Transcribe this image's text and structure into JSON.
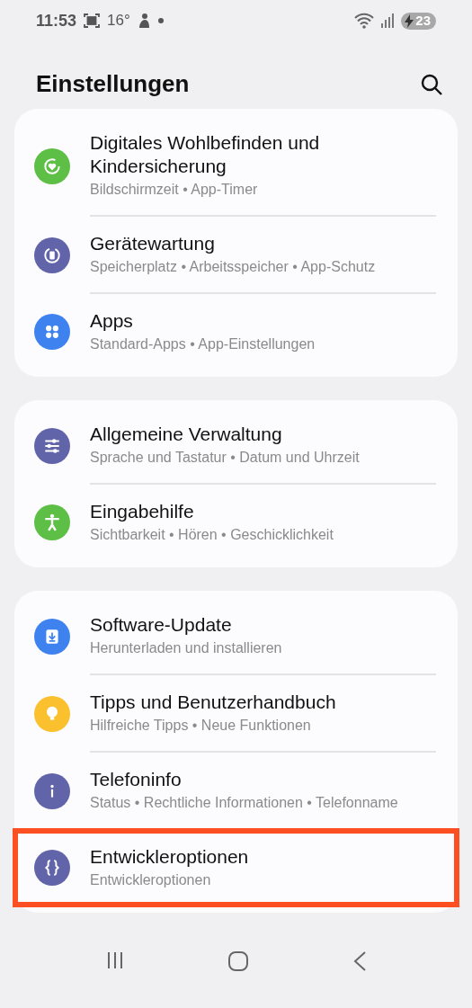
{
  "status_bar": {
    "time": "11:53",
    "temperature": "16°",
    "battery": "23"
  },
  "header": {
    "title": "Einstellungen"
  },
  "groups": [
    {
      "items": [
        {
          "kind": "wellbeing",
          "color": "#5dbf45",
          "title": "Digitales Wohlbefinden und Kindersicherung",
          "subtitle": "Bildschirmzeit • App-Timer",
          "highlighted": false
        },
        {
          "kind": "care",
          "color": "#6164a8",
          "title": "Gerätewartung",
          "subtitle": "Speicherplatz • Arbeitsspeicher • App-Schutz",
          "highlighted": false
        },
        {
          "kind": "apps",
          "color": "#3e82f0",
          "title": "Apps",
          "subtitle": "Standard-Apps • App-Einstellungen",
          "highlighted": false
        }
      ]
    },
    {
      "items": [
        {
          "kind": "sliders",
          "color": "#6164a8",
          "title": "Allgemeine Verwaltung",
          "subtitle": "Sprache und Tastatur • Datum und Uhrzeit",
          "highlighted": false
        },
        {
          "kind": "accessibility",
          "color": "#5dbf45",
          "title": "Eingabehilfe",
          "subtitle": "Sichtbarkeit • Hören • Geschicklichkeit",
          "highlighted": false
        }
      ]
    },
    {
      "items": [
        {
          "kind": "update",
          "color": "#3e82f0",
          "title": "Software-Update",
          "subtitle": "Herunterladen und installieren",
          "highlighted": false
        },
        {
          "kind": "bulb",
          "color": "#fbc02d",
          "title": "Tipps und Benutzerhandbuch",
          "subtitle": "Hilfreiche Tipps • Neue Funktionen",
          "highlighted": false
        },
        {
          "kind": "info",
          "color": "#6164a8",
          "title": "Telefoninfo",
          "subtitle": "Status • Rechtliche Informationen • Telefonname",
          "highlighted": false
        },
        {
          "kind": "braces",
          "color": "#6164a8",
          "title": "Entwickleroptionen",
          "subtitle": "Entwickleroptionen",
          "highlighted": true
        }
      ]
    }
  ]
}
